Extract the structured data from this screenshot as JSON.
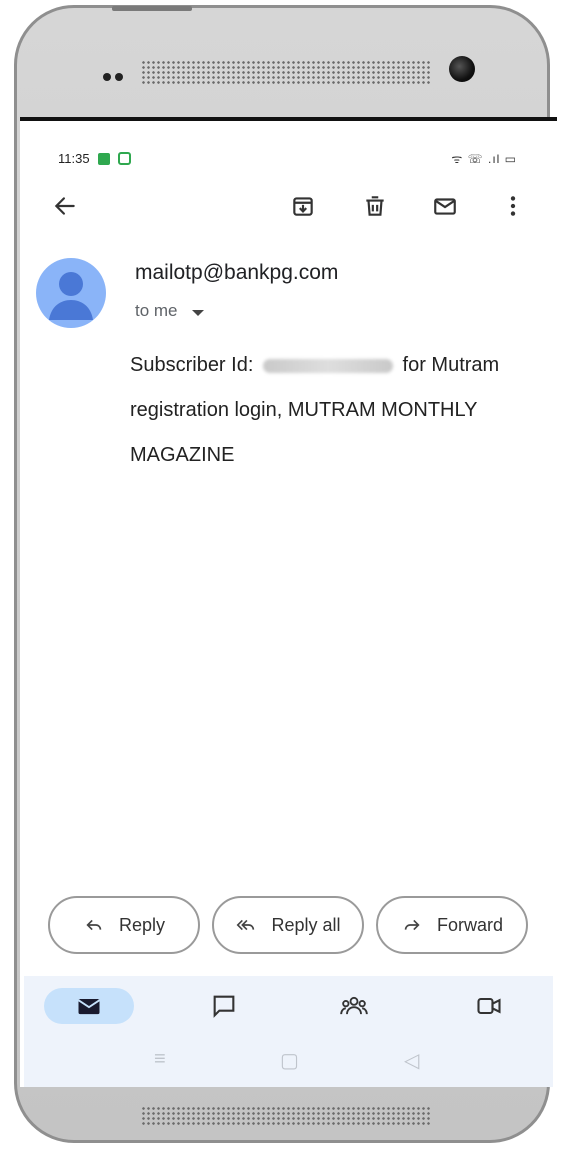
{
  "status_bar": {
    "time": "11:35",
    "indicators": "ᯤ ☏ .ıl ▭"
  },
  "toolbar": {
    "back_icon": "arrow-left-icon",
    "archive_icon": "archive-icon",
    "delete_icon": "trash-icon",
    "mark_unread_icon": "mail-icon",
    "more_icon": "more-vert-icon"
  },
  "email": {
    "sender": "mailotp@bankpg.com",
    "recipient": "to me",
    "body_prefix": "Subscriber Id:",
    "body_suffix": "for Mutram registration login, MUTRAM MONTHLY MAGAZINE"
  },
  "actions": {
    "reply": "Reply",
    "reply_all": "Reply all",
    "forward": "Forward"
  },
  "bottom_nav": {
    "items": [
      "mail-icon",
      "chat-icon",
      "spaces-icon",
      "meet-icon"
    ]
  },
  "colors": {
    "avatar": "#8ab4f8",
    "nav_active": "#c6e1fb",
    "nav_bg": "#eef3fb"
  }
}
